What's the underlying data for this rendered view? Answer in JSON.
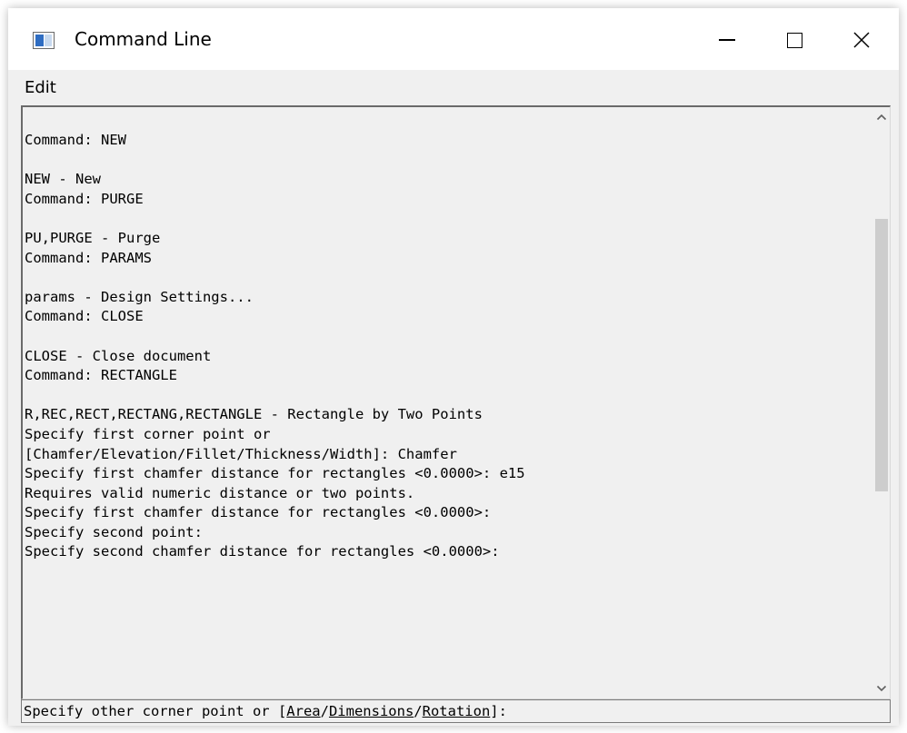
{
  "window": {
    "title": "Command Line"
  },
  "menu": {
    "edit_label": "Edit"
  },
  "output": {
    "lines": [
      "Command: NEW",
      "",
      "NEW - New",
      "Command: PURGE",
      "",
      "PU,PURGE - Purge",
      "Command: PARAMS",
      "",
      "params - Design Settings...",
      "Command: CLOSE",
      "",
      "CLOSE - Close document",
      "Command: RECTANGLE",
      "",
      "R,REC,RECT,RECTANG,RECTANGLE - Rectangle by Two Points",
      "Specify first corner point or",
      "[Chamfer/Elevation/Fillet/Thickness/Width]: Chamfer",
      "Specify first chamfer distance for rectangles <0.0000>: e15",
      "Requires valid numeric distance or two points.",
      "Specify first chamfer distance for rectangles <0.0000>:",
      "Specify second point:",
      "Specify second chamfer distance for rectangles <0.0000>:"
    ]
  },
  "prompt": {
    "prefix": "Specify other corner point or [",
    "options": [
      "Area",
      "Dimensions",
      "Rotation"
    ],
    "separator": "/",
    "suffix": "]:"
  },
  "scrollbar": {
    "position_fraction": 0.33
  },
  "colors": {
    "window_bg": "#f0f0f0",
    "titlebar_bg": "#ffffff",
    "text": "#000000",
    "scroll_thumb": "#cdcdcd",
    "icon_accent": "#2f6dc2"
  }
}
